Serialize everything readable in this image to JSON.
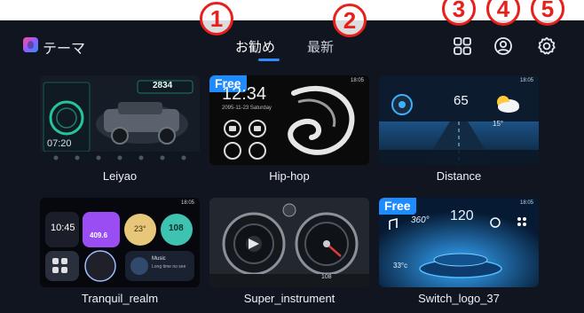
{
  "app": {
    "title": "テーマ"
  },
  "tabs": [
    {
      "label": "お勧め",
      "active": true
    },
    {
      "label": "最新",
      "active": false
    }
  ],
  "header_icons": [
    "grid-icon",
    "account-icon",
    "settings-icon"
  ],
  "annotations": [
    "1",
    "2",
    "3",
    "4",
    "5"
  ],
  "themes": [
    {
      "name": "Leiyao",
      "free": false,
      "preview": {
        "speed": "2834",
        "time": "07:20"
      }
    },
    {
      "name": "Hip-hop",
      "free": true,
      "badge": "Free",
      "preview": {
        "time": "12:34",
        "date": "2095-11-23 Saturday",
        "status_time": "18:05"
      }
    },
    {
      "name": "Distance",
      "free": false,
      "preview": {
        "value": "65",
        "temp": "15°",
        "status_time": "18:05"
      }
    },
    {
      "name": "Tranquil_realm",
      "free": false,
      "preview": {
        "time": "10:45",
        "temp": "23°",
        "value": "108",
        "speed": "409.6",
        "status_time": "18:05",
        "music": "Music",
        "song": "Long time no see"
      }
    },
    {
      "name": "Super_instrument",
      "free": false,
      "preview": {
        "value": "108"
      }
    },
    {
      "name": "Switch_logo_37",
      "free": true,
      "badge": "Free",
      "preview": {
        "deg": "360°",
        "value": "120",
        "temp": "33°c",
        "status_time": "18:05"
      }
    }
  ],
  "colors": {
    "background": "#10151f",
    "accent": "#2d8cff",
    "free_badge": "#1e8bff",
    "annotation": "#e8201c"
  }
}
